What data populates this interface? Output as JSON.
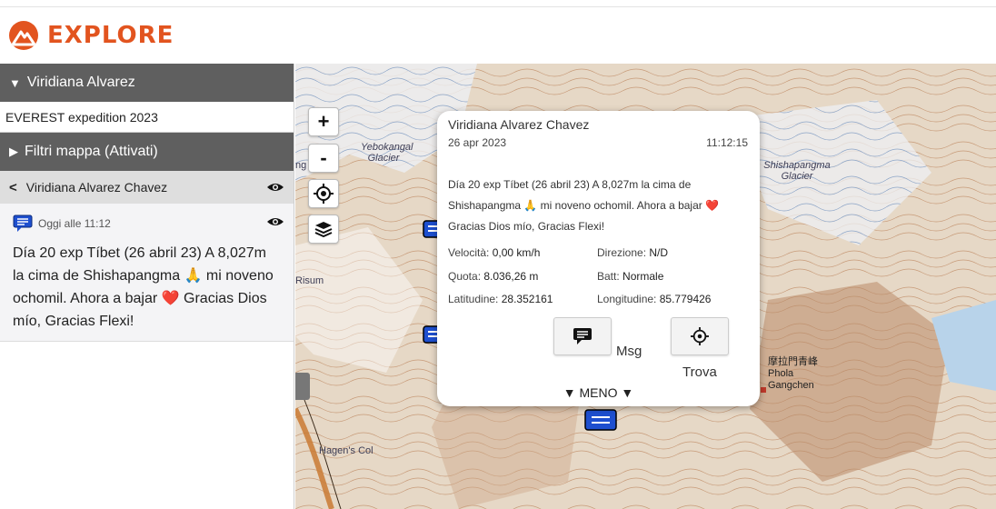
{
  "app": {
    "logo_text": "EXPLORE"
  },
  "sidebar": {
    "user_label": "Viridiana Alvarez",
    "trip_label": "EVEREST expedition 2023",
    "filter_label": "Filtri mappa (Attivati)",
    "person_label": "Viridiana Alvarez Chavez",
    "message": {
      "time": "Oggi alle 11:12",
      "text": "Día 20 exp Tíbet (26 abril 23) A 8,027m la cima de Shishapangma 🙏 mi noveno ochomil. Ahora a bajar ❤️ Gracias Dios mío, Gracias Flexi!"
    }
  },
  "map": {
    "zoom_in_label": "+",
    "zoom_out_label": "-",
    "labels": {
      "yebokangal": "Yebokangal Glacier",
      "shishapangma": "Shishapangma Glacier",
      "risum": "Risum",
      "hagens_col": "Hagen's Col",
      "phola": "摩拉門青峰 Phola Gangchen",
      "contour_ng": "ng"
    }
  },
  "popup": {
    "name": "Viridiana Alvarez Chavez",
    "date": "26 apr 2023",
    "time": "11:12:15",
    "message": "Día 20 exp Tíbet (26 abril 23) A 8,027m la cima de Shishapangma 🙏 mi noveno ochomil. Ahora a bajar ❤️ Gracias Dios mío, Gracias Flexi!",
    "fields": {
      "velocita_label": "Velocità:",
      "velocita_value": "0,00 km/h",
      "direzione_label": "Direzione:",
      "direzione_value": "N/D",
      "quota_label": "Quota:",
      "quota_value": "8.036,26 m",
      "batt_label": "Batt:",
      "batt_value": "Normale",
      "lat_label": "Latitudine:",
      "lat_value": "28.352161",
      "lon_label": "Longitudine:",
      "lon_value": "85.779426"
    },
    "msg_button_label": "Msg",
    "trova_button_label": "Trova",
    "menu_label": "▼ MENO ▼"
  },
  "colors": {
    "brand": "#e2541f",
    "sidebar_dark": "#5f5f5f",
    "marker_blue": "#1e4fcf"
  }
}
